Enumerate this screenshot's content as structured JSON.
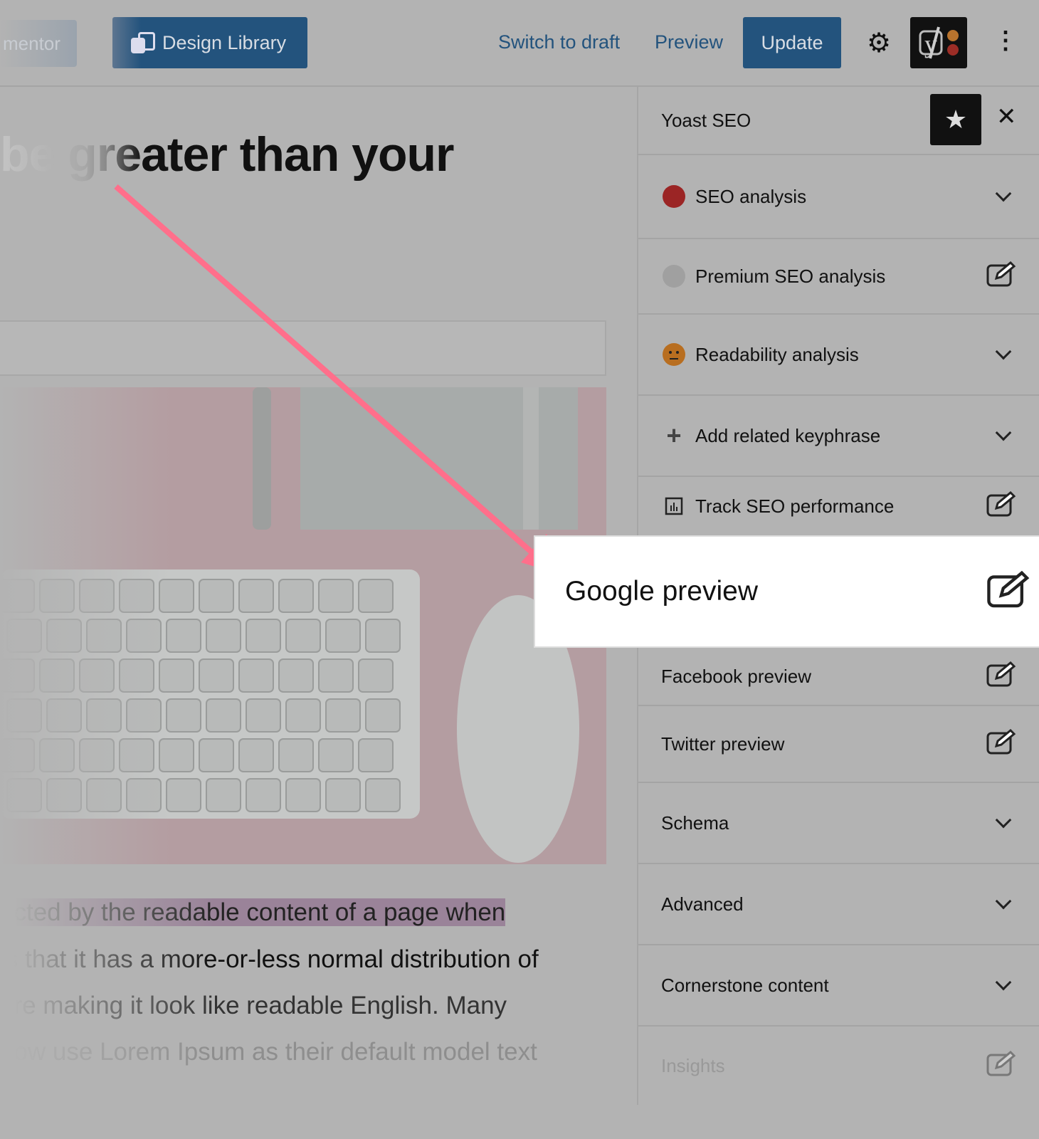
{
  "toolbar": {
    "elementor_label": "mentor",
    "design_library_label": "Design Library",
    "switch_to_draft": "Switch to draft",
    "preview": "Preview",
    "update": "Update",
    "settings_icon": "gear-icon",
    "yoast_icon": "yoast-logo",
    "more_icon": "kebab-icon"
  },
  "editor": {
    "title": "be greater than your",
    "paragraphs": [
      "acted by the readable content of a page when",
      "is that it has a more-or-less normal distribution of",
      "ere making it look like readable English. Many",
      "now use Lorem Ipsum as their default model text"
    ]
  },
  "sidebar": {
    "title": "Yoast SEO",
    "star_icon": "star-icon",
    "close_icon": "close-icon",
    "items": [
      {
        "label": "SEO analysis",
        "icon": "red-dot",
        "status_color": "#9b2525",
        "action": "chevron-down"
      },
      {
        "label": "Premium SEO analysis",
        "icon": "gray-dot",
        "status_color": "#a0a0a0",
        "action": "edit"
      },
      {
        "label": "Readability analysis",
        "icon": "orange-face",
        "status_color": "#b86e20",
        "action": "chevron-down"
      },
      {
        "label": "Add related keyphrase",
        "icon": "plus",
        "action": "chevron-down"
      },
      {
        "label": "Track SEO performance",
        "icon": "chart",
        "action": "edit"
      },
      {
        "label": "Google preview",
        "action": "edit"
      },
      {
        "label": "Facebook preview",
        "action": "edit"
      },
      {
        "label": "Twitter preview",
        "action": "edit"
      },
      {
        "label": "Schema",
        "action": "chevron-down"
      },
      {
        "label": "Advanced",
        "action": "chevron-down"
      },
      {
        "label": "Cornerstone content",
        "action": "chevron-down"
      },
      {
        "label": "Insights",
        "action": "edit"
      }
    ]
  },
  "colors": {
    "accent": "#23537d",
    "arrow": "#ff6f8b",
    "highlight": "#9a8399"
  }
}
